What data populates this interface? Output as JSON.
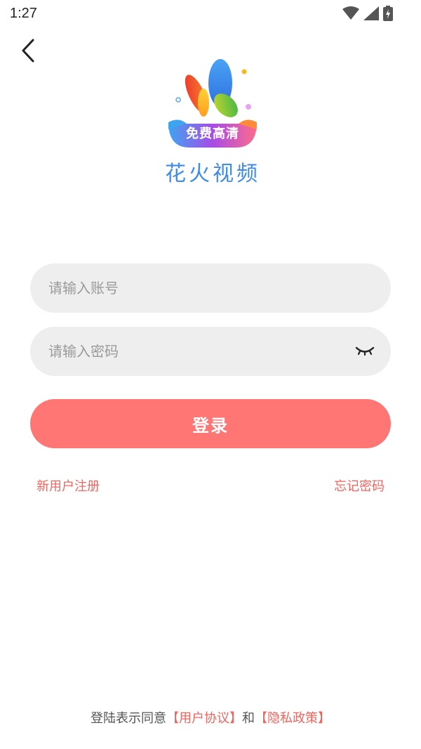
{
  "status_bar": {
    "time": "1:27"
  },
  "app": {
    "badge_text": "免费高清",
    "name": "花火视频"
  },
  "form": {
    "account_placeholder": "请输入账号",
    "password_placeholder": "请输入密码",
    "login_label": "登录"
  },
  "links": {
    "register": "新用户注册",
    "forgot": "忘记密码"
  },
  "agreement": {
    "prefix": "登陆表示同意",
    "user_agreement": "【用户协议】",
    "conjunction": "和",
    "privacy_policy": "【隐私政策】"
  },
  "colors": {
    "accent": "#ff7675",
    "link": "#f2655f",
    "brand_blue": "#3e8be8",
    "field_bg": "#eeeeee"
  }
}
